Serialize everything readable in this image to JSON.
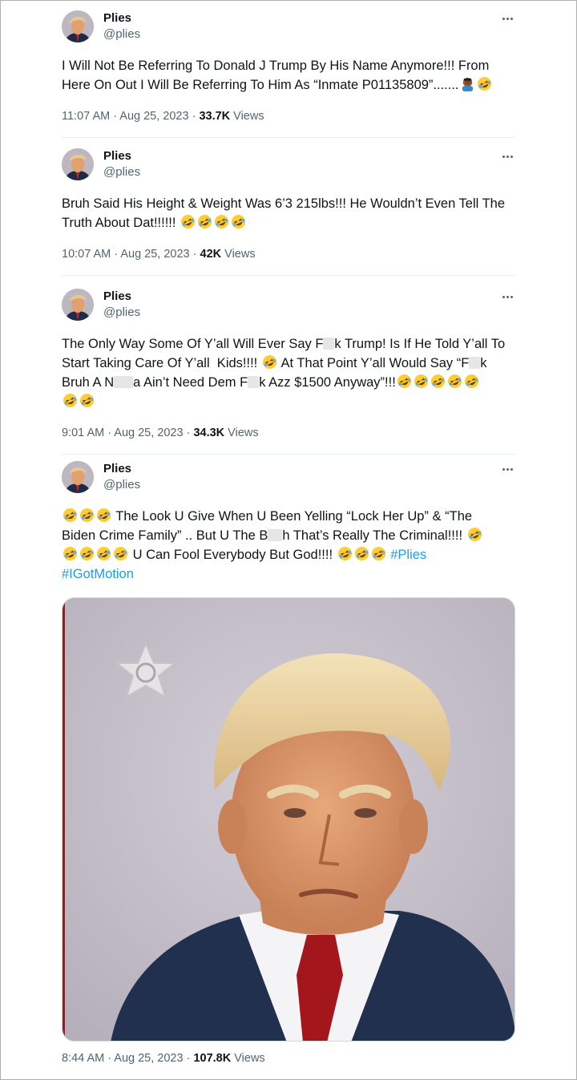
{
  "tweets": [
    {
      "name": "Plies",
      "handle": "@plies",
      "text_parts": [
        "I Will Not Be Referring To Donald J Trump By His Name Anymore!!! From Here On Out I Will Be Referring To Him As “Inmate P01135809”.......",
        "🤦🏾‍♂️",
        "🤣"
      ],
      "time": "11:07 AM · Aug 25, 2023 · ",
      "views_count": "33.7K",
      "views_label": " Views"
    },
    {
      "name": "Plies",
      "handle": "@plies",
      "text_parts": [
        "Bruh Said His Height & Weight Was 6’3 215lbs!!! He Wouldn’t Even Tell The Truth About Dat!!!!!! "
      ],
      "time": "10:07 AM · Aug 25, 2023 · ",
      "views_count": "42K",
      "views_label": " Views"
    },
    {
      "name": "Plies",
      "handle": "@plies",
      "line1_a": "The Only Way Some Of Y’all Will Ever Say F",
      "line1_b": "k Trump! Is If He Told Y’all To",
      "line2_a": "Start Taking Care Of Y’all  Kids!!!! ",
      "line2_b": " At That Point Y’all Would Say “F",
      "line2_c": "k",
      "line3_a": "Bruh A N",
      "line3_b": "a Ain’t Need Dem F",
      "line3_c": "k Azz $1500 Anyway”!!!",
      "time": "9:01 AM · Aug 25, 2023 · ",
      "views_count": "34.3K",
      "views_label": " Views"
    },
    {
      "name": "Plies",
      "handle": "@plies",
      "line1": " The Look U Give When U Been Yelling “Lock Her Up” & “The",
      "line2_a": "Biden Crime Family” .. But U The B",
      "line2_b": "h That’s Really The Criminal!!!! ",
      "line3": " U Can Fool Everybody But God!!!! ",
      "hashtag1": "#Plies",
      "hashtag2": "#IGotMotion",
      "time": "8:44 AM · Aug 25, 2023 · ",
      "views_count": "107.8K",
      "views_label": " Views"
    }
  ],
  "colors": {
    "text": "#0f1419",
    "secondary": "#536471",
    "link": "#1d9bf0",
    "divider": "#e6ecf0"
  },
  "icons": {
    "more": "more-dots-icon",
    "laugh": "rolling-on-floor-laughing-emoji",
    "facepalm": "man-facepalming-emoji"
  }
}
